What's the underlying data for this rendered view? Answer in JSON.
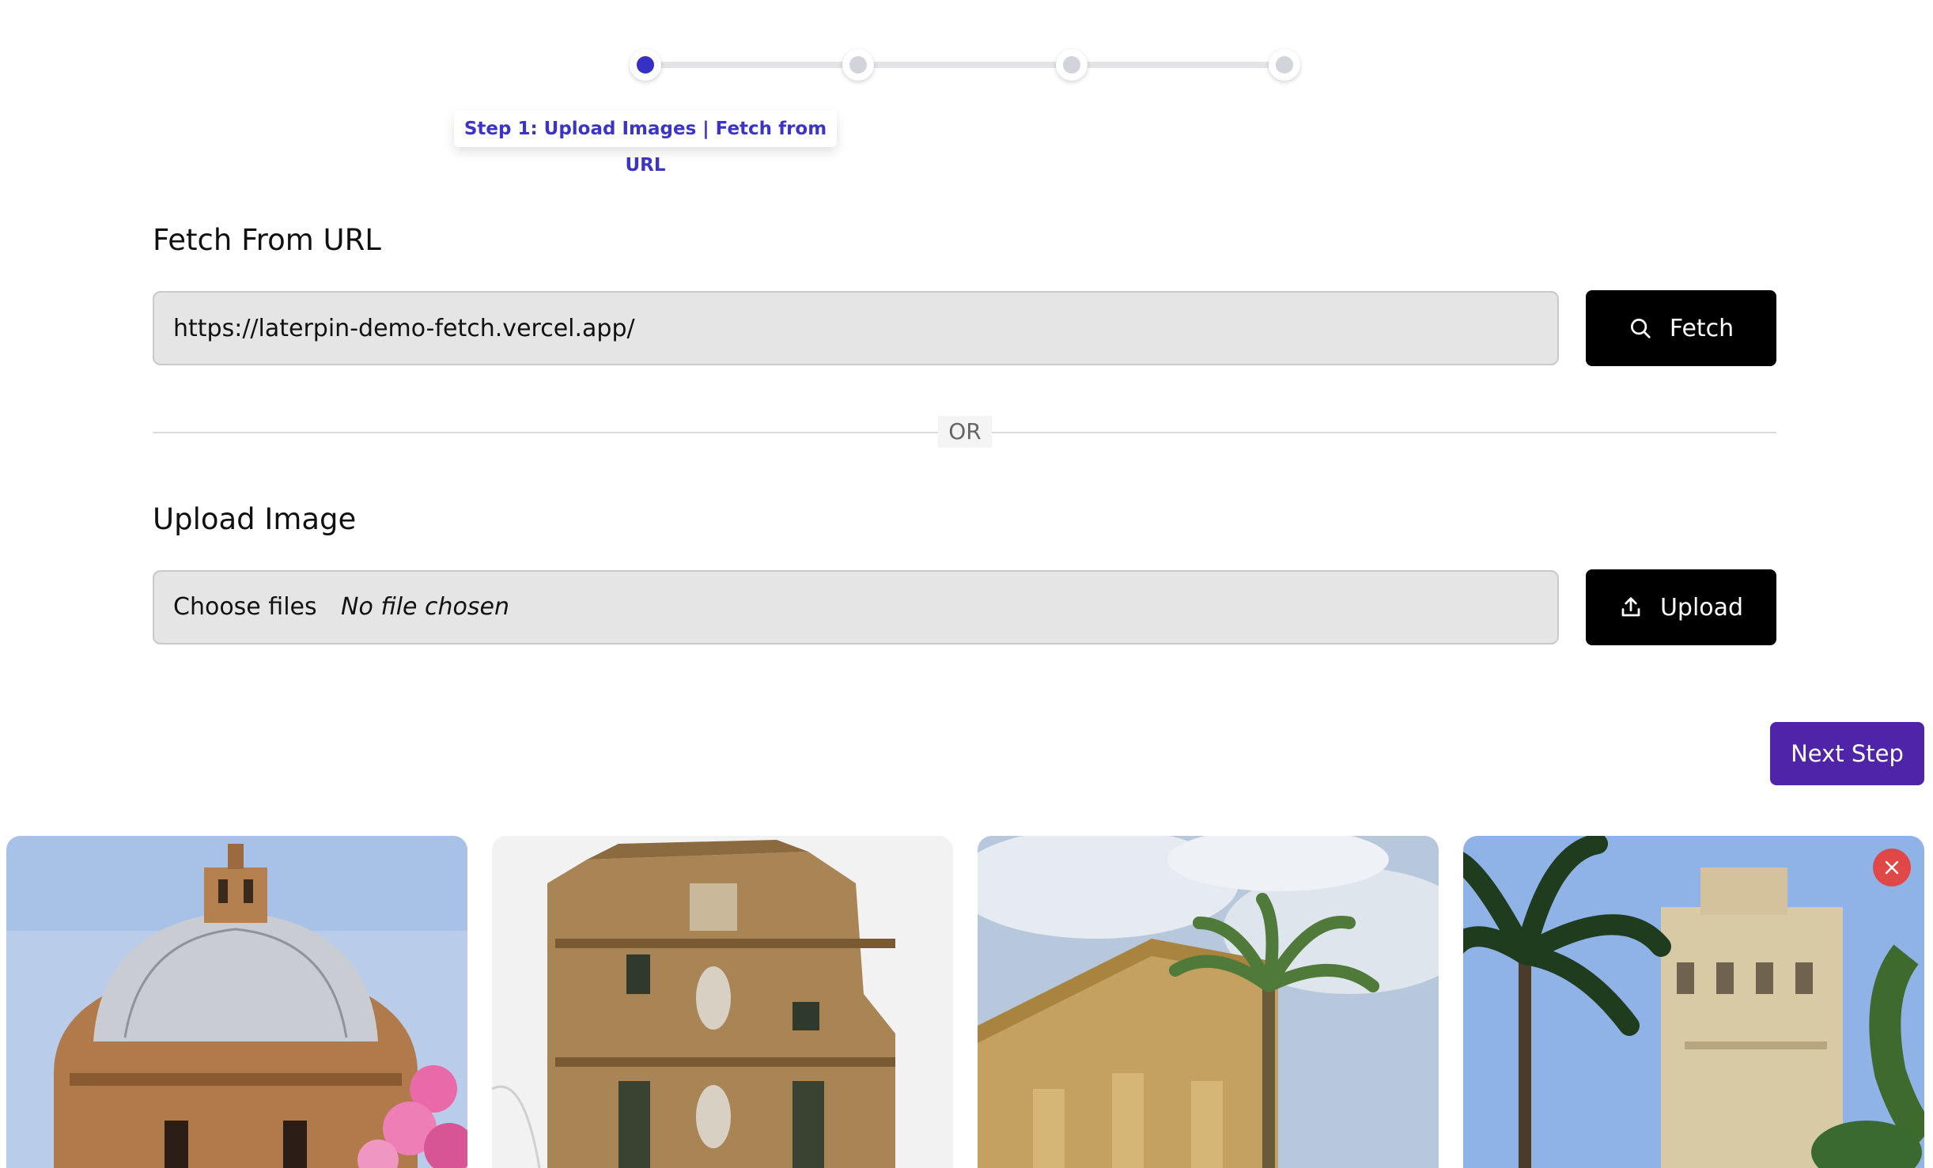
{
  "stepper": {
    "current_step_label": "Step 1: Upload Images | Fetch from URL",
    "total_steps": 4,
    "active_step": 1
  },
  "fetch": {
    "title": "Fetch From URL",
    "url_value": "https://laterpin-demo-fetch.vercel.app/",
    "button_label": "Fetch",
    "button_icon": "search-icon"
  },
  "divider": {
    "label": "OR"
  },
  "upload": {
    "title": "Upload Image",
    "choose_label": "Choose files",
    "status": "No file chosen",
    "button_label": "Upload",
    "button_icon": "upload-icon"
  },
  "next_button": {
    "label": "Next Step"
  },
  "gallery": {
    "images": [
      {
        "subject": "cathedral dome with pink flowers"
      },
      {
        "subject": "baroque church facade"
      },
      {
        "subject": "neoclassical theatre with palm tree"
      },
      {
        "subject": "palace with palm trees",
        "removable": true
      }
    ],
    "remove_icon": "close-icon"
  },
  "colors": {
    "accent": "#3730c4",
    "next_button": "#4f24a8",
    "action_button": "#000000",
    "remove_button": "#e04848"
  }
}
